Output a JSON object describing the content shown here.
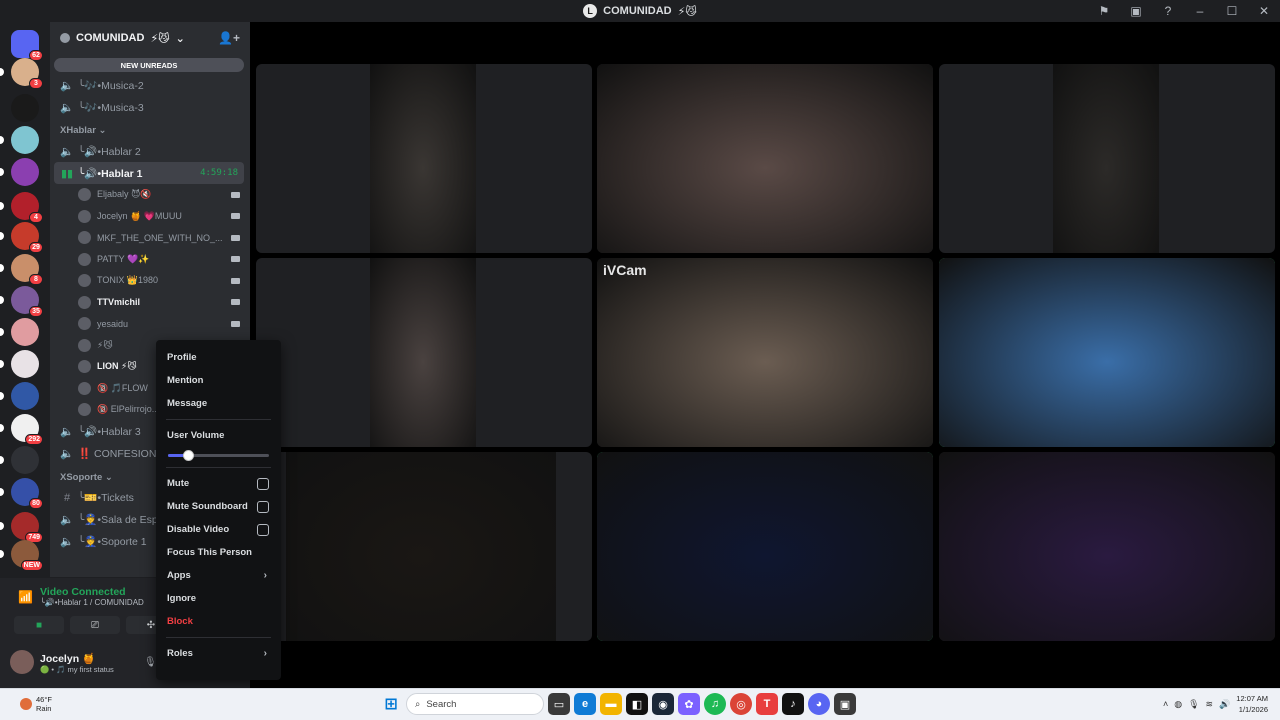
{
  "window": {
    "title": "COMUNIDAD"
  },
  "guild": {
    "name": "COMUNIDAD",
    "new_unreads": "NEW UNREADS"
  },
  "servers": [
    {
      "color": "#5865f2",
      "badge": "62"
    },
    {
      "color": "#d9b08c",
      "badge": "3"
    },
    {
      "color": "#1a1a1a",
      "badge": ""
    },
    {
      "color": "#7fc5d1",
      "badge": ""
    },
    {
      "color": "#8b3fb0",
      "badge": ""
    },
    {
      "color": "#b2202b",
      "badge": "4"
    },
    {
      "color": "#c63b2b",
      "badge": "29"
    },
    {
      "color": "#c98f6a",
      "badge": "8"
    },
    {
      "color": "#7b5a9b",
      "badge": "35"
    },
    {
      "color": "#e09ca0",
      "badge": ""
    },
    {
      "color": "#e8e2e6",
      "badge": ""
    },
    {
      "color": "#3058a6",
      "badge": ""
    },
    {
      "color": "#f0f0f0",
      "badge": "292"
    },
    {
      "color": "#2f3136",
      "badge": ""
    },
    {
      "color": "#3550a8",
      "badge": "80"
    },
    {
      "color": "#a52a2a",
      "badge": "749"
    },
    {
      "color": "#8c5a3c",
      "badge": "NEW"
    }
  ],
  "channels": [
    {
      "name": "╰🎶•Musica-2"
    },
    {
      "name": "╰🎶•Musica-3"
    }
  ],
  "category_hablar": "XHablar",
  "hablar": [
    {
      "name": "╰🔊•Hablar 2"
    }
  ],
  "active_channel": {
    "name": "╰🔊•Hablar 1",
    "timer": "4:59:18"
  },
  "voice_users": [
    {
      "name": "Eljabaly 😈🔇"
    },
    {
      "name": "Jocelyn 🍯 💗MUUU"
    },
    {
      "name": "MKF_THE_ONE_WITH_NO_..."
    },
    {
      "name": "PATTY 💜✨"
    },
    {
      "name": "TONIX 👑1980"
    },
    {
      "name": "TTVmichil"
    },
    {
      "name": "yesaidu"
    },
    {
      "name": "⚡😼"
    },
    {
      "name": "LION ⚡😼"
    },
    {
      "name": "🔞 🎵FLOW"
    },
    {
      "name": "🔞 ElPelirrojo..."
    }
  ],
  "after_users": [
    {
      "name": "╰🔊•Hablar 3"
    },
    {
      "name": "‼️ CONFESIONE..."
    }
  ],
  "category_soporte": "XSoporte",
  "soporte": [
    {
      "name": "╰🎫•Tickets"
    },
    {
      "name": "╰👮•Sala de Esp..."
    },
    {
      "name": "╰👮•Soporte 1"
    }
  ],
  "voice_panel": {
    "status": "Video Connected",
    "subtitle": "╰🔊•Hablar 1 / COMUNIDAD"
  },
  "user": {
    "name": "Jocelyn 🍯",
    "status": "🟢 • 🎵 my first status"
  },
  "context_menu": {
    "items_top": [
      "Profile",
      "Mention",
      "Message"
    ],
    "user_volume_label": "User Volume",
    "user_volume": 0.2,
    "checks": [
      "Mute",
      "Mute Soundboard",
      "Disable Video"
    ],
    "focus": "Focus This Person",
    "apps": "Apps",
    "ignore": "Ignore",
    "block": "Block",
    "roles": "Roles"
  },
  "video_tiles": [
    {
      "label": "",
      "speaking": false
    },
    {
      "label": "",
      "speaking": false
    },
    {
      "label": "",
      "speaking": false
    },
    {
      "label": "",
      "speaking": false
    },
    {
      "label": "iVCam",
      "speaking": false
    },
    {
      "label": "",
      "speaking": true
    },
    {
      "label": "",
      "speaking": false
    },
    {
      "label": "",
      "speaking": true
    },
    {
      "label": "",
      "speaking": false
    }
  ],
  "taskbar": {
    "temp": "46°F",
    "weather": "Rain",
    "search_placeholder": "Search",
    "time": "12:07 AM",
    "date": "1/1/2026"
  },
  "colors": {
    "accent": "#5865f2",
    "speaking": "#23a55a",
    "danger": "#f23f43"
  }
}
